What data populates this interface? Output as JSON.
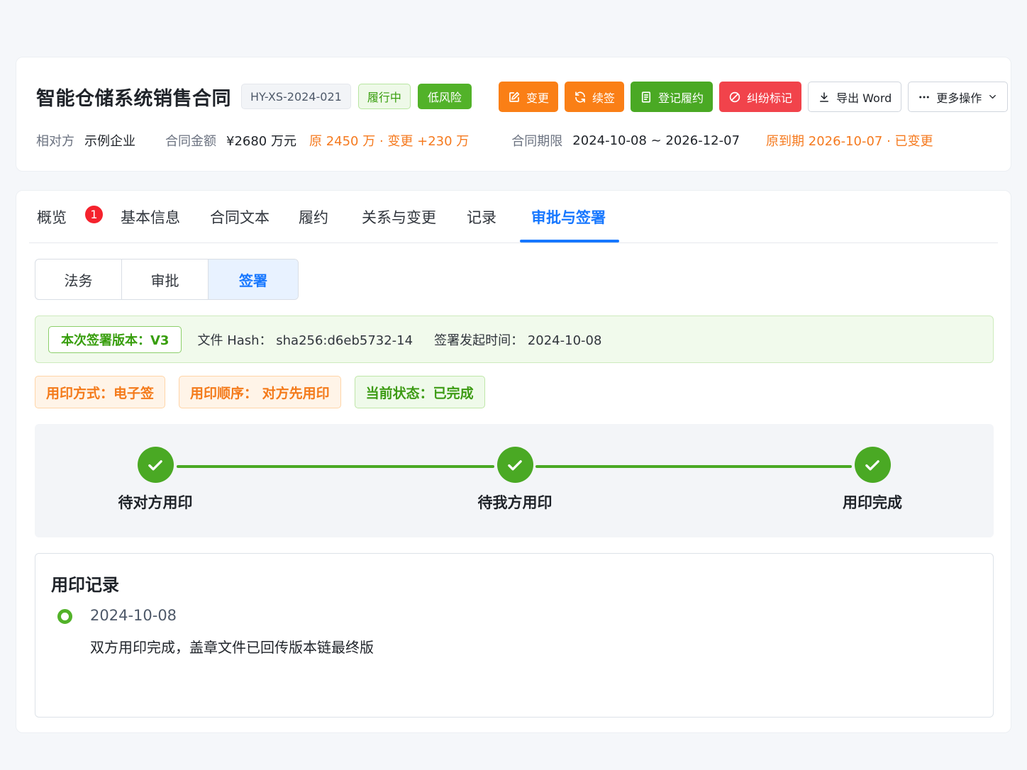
{
  "header": {
    "title": "智能仓储系统销售合同",
    "code": "HY-XS-2024-021",
    "status": "履行中",
    "risk": "低风险",
    "actions": [
      {
        "label": "变更",
        "icon": "edit-icon",
        "style": "orange"
      },
      {
        "label": "续签",
        "icon": "refresh-icon",
        "style": "orange"
      },
      {
        "label": "登记履约",
        "icon": "register-icon",
        "style": "green"
      },
      {
        "label": "纠纷标记",
        "icon": "ban-icon",
        "style": "red"
      },
      {
        "label": "导出 Word",
        "icon": "download-icon",
        "style": "plain"
      },
      {
        "label": "更多操作",
        "icon": "more-icon",
        "style": "plain"
      }
    ],
    "meta": {
      "party_label": "相对方",
      "party_value": "示例企业",
      "amount_label": "合同金额",
      "amount_value": "¥2680 万元",
      "amount_note": "原 2450 万 · 变更 +230 万",
      "period_label": "合同期限",
      "period_value": "2024-10-08 ~ 2026-12-07",
      "period_note": "原到期 2026-10-07 · 已变更"
    }
  },
  "tabs": {
    "items": [
      "概览",
      "基本信息",
      "合同文本",
      "履约",
      "关系与变更",
      "记录",
      "审批与签署"
    ],
    "active": "审批与签署",
    "badge": "1"
  },
  "segments": {
    "items": [
      "法务",
      "审批",
      "签署"
    ],
    "active": "签署"
  },
  "version_bar": {
    "version": "本次签署版本：V3",
    "hash": "文件 Hash：  sha256:d6eb5732-14",
    "time": "签署发起时间：  2024-10-08"
  },
  "chips": {
    "method": "用印方式：电子签",
    "order": "用印顺序：  对方先用印",
    "state": "当前状态：已完成"
  },
  "steps": [
    "待对方用印",
    "待我方用印",
    "用印完成"
  ],
  "records": {
    "title": "用印记录",
    "date": "2024-10-08",
    "text": "双方用印完成，盖章文件已回传版本链最终版"
  },
  "colors": {
    "primary": "#1677ff",
    "success": "#4aa924",
    "warning": "#fa7f16",
    "danger": "#f1434b"
  }
}
